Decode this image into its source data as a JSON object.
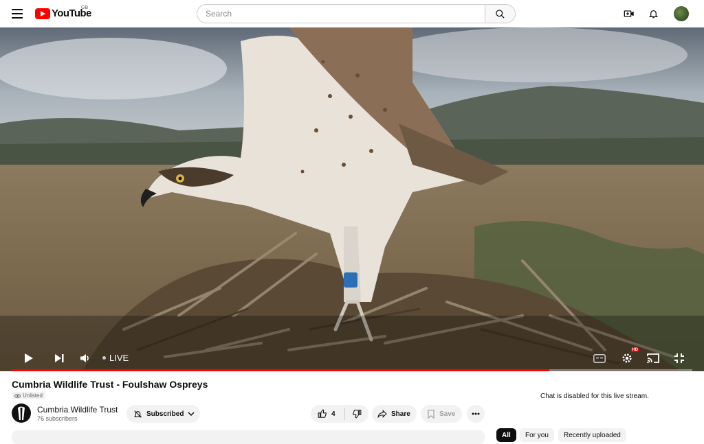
{
  "header": {
    "logo_text": "YouTube",
    "region": "GB",
    "search_placeholder": "Search"
  },
  "player": {
    "live_label": "LIVE",
    "progress_fraction": 0.79
  },
  "video": {
    "title": "Cumbria Wildlife Trust - Foulshaw Ospreys",
    "visibility": "Unlisted"
  },
  "channel": {
    "name": "Cumbria Wildlife Trust",
    "subscribers": "76 subscribers",
    "subscribe_label": "Subscribed"
  },
  "actions": {
    "like_count": "4",
    "share_label": "Share",
    "save_label": "Save"
  },
  "chat": {
    "disabled_text": "Chat is disabled for this live stream."
  },
  "chips": [
    {
      "label": "All"
    },
    {
      "label": "For you"
    },
    {
      "label": "Recently uploaded"
    }
  ],
  "colors": {
    "brand": "#ff0000",
    "progress": "#ff0000"
  }
}
